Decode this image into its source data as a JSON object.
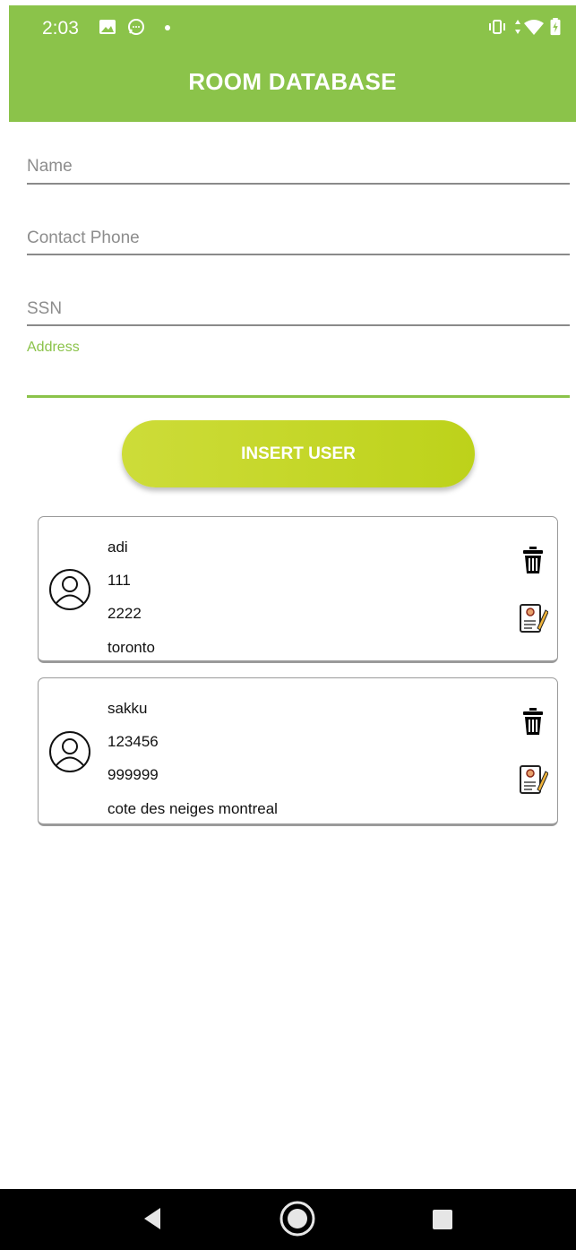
{
  "status_bar": {
    "time": "2:03"
  },
  "app_bar": {
    "title": "ROOM DATABASE",
    "color": "#8bc34a"
  },
  "form": {
    "name_placeholder": "Name",
    "phone_placeholder": "Contact Phone",
    "ssn_placeholder": "SSN",
    "address_label": "Address",
    "insert_button": "INSERT USER"
  },
  "users": [
    {
      "name": "adi",
      "phone": "111",
      "ssn": "2222",
      "address": "toronto"
    },
    {
      "name": "sakku",
      "phone": "123456",
      "ssn": "999999",
      "address": "cote des neiges montreal"
    }
  ],
  "icons": {
    "user": "user-avatar-icon",
    "delete": "trash-icon",
    "edit": "edit-document-icon"
  }
}
